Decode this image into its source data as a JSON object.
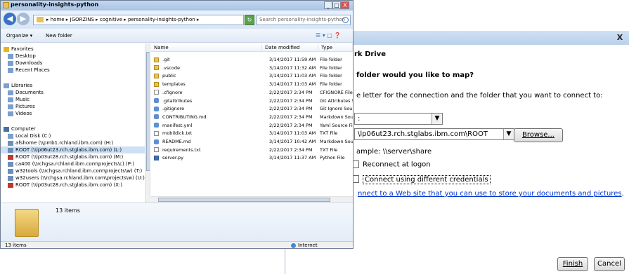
{
  "explorer": {
    "title": "personality-insights-python",
    "controls": {
      "minimize": "_",
      "maximize": "□",
      "close": "X"
    },
    "address": "▸ home ▸ JGORZINS ▸ cognitive ▸ personality-insights-python ▸",
    "search_placeholder": "Search personality-insights-python",
    "toolbar": {
      "organize": "Organize ▾",
      "new_folder": "New folder"
    },
    "nav": [
      {
        "label": "Favorites",
        "icon": "star-icon",
        "selected": false
      },
      {
        "label": "Desktop",
        "icon": "desktop-icon",
        "selected": false
      },
      {
        "label": "Downloads",
        "icon": "downloads-icon",
        "selected": false
      },
      {
        "label": "Recent Places",
        "icon": "recent-places-icon",
        "selected": false
      },
      {
        "label": "Libraries",
        "icon": "libraries-icon",
        "selected": false
      },
      {
        "label": "Documents",
        "icon": "documents-icon",
        "selected": false
      },
      {
        "label": "Music",
        "icon": "music-icon",
        "selected": false
      },
      {
        "label": "Pictures",
        "icon": "pictures-icon",
        "selected": false
      },
      {
        "label": "Videos",
        "icon": "videos-icon",
        "selected": false
      },
      {
        "label": "Computer",
        "icon": "computer-icon",
        "selected": false
      },
      {
        "label": "Local Disk (C:)",
        "icon": "disk-icon",
        "selected": false
      },
      {
        "label": "afshome (\\\\pmb1.rchland.ibm.com) (H:)",
        "icon": "network-drive-icon",
        "selected": false
      },
      {
        "label": "ROOT (\\\\lp06ut23.rch.stglabs.ibm.com) (L:)",
        "icon": "network-drive-icon",
        "selected": true
      },
      {
        "label": "ROOT (\\\\lp03ut28.rch.stglabs.ibm.com) (M:)",
        "icon": "network-drive-disconnected-icon",
        "selected": false
      },
      {
        "label": "ca400 (\\\\rchgsa.rchland.ibm.com\\projects\\c) (P:)",
        "icon": "network-drive-icon",
        "selected": false
      },
      {
        "label": "w32tools (\\\\rchgsa.rchland.ibm.com\\projects\\w) (T:)",
        "icon": "network-drive-icon",
        "selected": false
      },
      {
        "label": "w32users (\\\\rchgsa.rchland.ibm.com\\projects\\w) (U:)",
        "icon": "network-drive-icon",
        "selected": false
      },
      {
        "label": "ROOT (\\\\lp03ut28.rch.stglabs.ibm.com) (X:)",
        "icon": "network-drive-disconnected-icon",
        "selected": false
      }
    ],
    "columns": {
      "name": "Name",
      "date": "Date modified",
      "type": "Type"
    },
    "files": [
      {
        "name": ".git",
        "date": "3/14/2017 11:59 AM",
        "type": "File folder",
        "icon": "folder"
      },
      {
        "name": ".vscode",
        "date": "3/14/2017 11:32 AM",
        "type": "File folder",
        "icon": "folder"
      },
      {
        "name": "public",
        "date": "3/14/2017 11:03 AM",
        "type": "File folder",
        "icon": "folder"
      },
      {
        "name": "templates",
        "date": "3/14/2017 11:03 AM",
        "type": "File folder",
        "icon": "folder"
      },
      {
        "name": ".cfignore",
        "date": "2/22/2017 2:34 PM",
        "type": "CFIGNORE File",
        "icon": "file"
      },
      {
        "name": ".gitattributes",
        "date": "2/22/2017 2:34 PM",
        "type": "Git Attributes Sou",
        "icon": "arrow"
      },
      {
        "name": ".gitignore",
        "date": "2/22/2017 2:34 PM",
        "type": "Git Ignore Source",
        "icon": "arrow"
      },
      {
        "name": "CONTRIBUTING.md",
        "date": "2/22/2017 2:34 PM",
        "type": "Markdown Source",
        "icon": "arrow"
      },
      {
        "name": "manifest.yml",
        "date": "2/22/2017 2:34 PM",
        "type": "Yaml Source File",
        "icon": "arrow"
      },
      {
        "name": "mobildick.txt",
        "date": "3/14/2017 11:03 AM",
        "type": "TXT File",
        "icon": "file"
      },
      {
        "name": "README.md",
        "date": "3/14/2017 10:42 AM",
        "type": "Markdown Source",
        "icon": "arrow"
      },
      {
        "name": "requirements.txt",
        "date": "2/22/2017 2:34 PM",
        "type": "TXT File",
        "icon": "file"
      },
      {
        "name": "server.py",
        "date": "3/14/2017 11:37 AM",
        "type": "Python File",
        "icon": "py"
      }
    ],
    "details_count": "13 items",
    "status_count": "13 items",
    "status_zone": "Internet"
  },
  "map_dialog": {
    "close": "X",
    "caption": "rk Drive",
    "question": "folder would you like to map?",
    "instruction": "e letter for the connection and the folder that you want to connect to:",
    "drive_value": ":",
    "folder_value": "\\lp06ut23.rch.stglabs.ibm.com\\ROOT",
    "browse_label": "Browse...",
    "example": "ample: \\\\server\\share",
    "reconnect_label": "Reconnect at logon",
    "credentials_label": "Connect using different credentials",
    "web_link": "nnect to a Web site that you can use to store your documents and pictures",
    "web_link_suffix": ".",
    "finish_label": "Finish",
    "cancel_label": "Cancel"
  }
}
